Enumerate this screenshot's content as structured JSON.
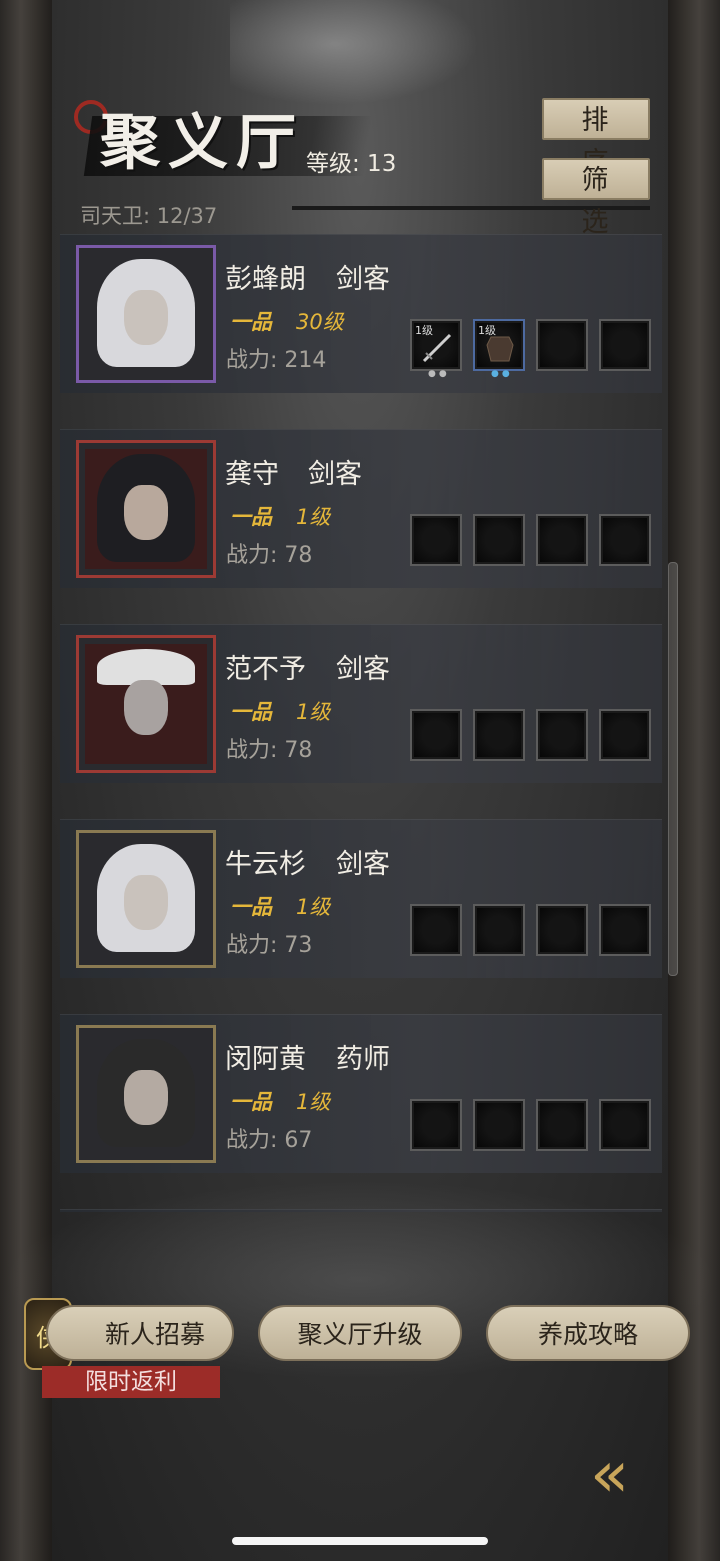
{
  "header": {
    "title": "聚义厅",
    "level_text": "等级: 13",
    "guard_text": "司天卫: 12/37",
    "sort_label": "排序",
    "filter_label": "筛选"
  },
  "heroes": [
    {
      "name": "彭蜂朗",
      "role": "剑客",
      "grade": "一品",
      "level": "30级",
      "power": "战力: 214",
      "frame_color": "#7a5aa8",
      "hair": "#d8d8dc",
      "slots": [
        {
          "level": "1级",
          "icon": "sword-icon"
        },
        {
          "level": "1级",
          "icon": "armor-icon"
        },
        {
          "level": "",
          "icon": "empty"
        },
        {
          "level": "",
          "icon": "empty"
        }
      ]
    },
    {
      "name": "龚守",
      "role": "剑客",
      "grade": "一品",
      "level": "1级",
      "power": "战力: 78",
      "frame_color": "#9c3a34",
      "hair": "#1e1e22",
      "slots": []
    },
    {
      "name": "范不予",
      "role": "剑客",
      "grade": "一品",
      "level": "1级",
      "power": "战力: 78",
      "frame_color": "#9c3a34",
      "hair": "#e0e0e0",
      "slots": []
    },
    {
      "name": "牛云杉",
      "role": "剑客",
      "grade": "一品",
      "level": "1级",
      "power": "战力: 73",
      "frame_color": "#8a7a52",
      "hair": "#d8d8dc",
      "slots": []
    },
    {
      "name": "闵阿黄",
      "role": "药师",
      "grade": "一品",
      "level": "1级",
      "power": "战力: 67",
      "frame_color": "#8a7a52",
      "hair": "#2a2a2a",
      "slots": []
    }
  ],
  "footer": {
    "recruit_label": "新人招募",
    "upgrade_label": "聚义厅升级",
    "guide_label": "养成攻略",
    "promo_label": "限时返利",
    "badge_text": "侠",
    "back_symbol": "«"
  }
}
